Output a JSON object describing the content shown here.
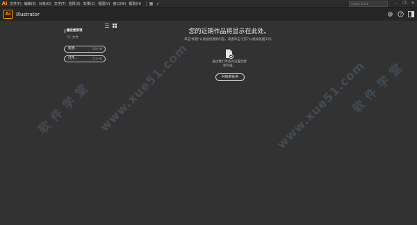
{
  "menubar": {
    "logo": "Ai",
    "items": [
      "文件(F)",
      "编辑(E)",
      "对象(O)",
      "文字(T)",
      "选择(S)",
      "效果(C)",
      "视图(V)",
      "窗口(W)",
      "帮助(H)"
    ],
    "search_placeholder": "Adobe Stock",
    "controls": [
      "–",
      "❐",
      "✕"
    ]
  },
  "header": {
    "logo": "Ai",
    "title": "Illustrator",
    "icons": [
      "gear-icon",
      "help-icon",
      "panel-icon"
    ]
  },
  "sidebar": {
    "recent_label": "最近使用项",
    "cc_label": "CC 文件",
    "new_button": "新建...",
    "new_shortcut": "Ctrl+N",
    "open_button": "打开...",
    "open_shortcut": "Ctrl+O"
  },
  "main": {
    "title": "您的近期作品将显示在此处。",
    "subtitle": "单击\"新建\"以快速创建新内容，或者单击\"打开\"以继续处理工作。",
    "hint_line1": "通过我们带有的设置创建",
    "hint_line2": "新内容。",
    "start_button": "开始新任务"
  },
  "watermarks": [
    "软 件 学 堂",
    "www.xue51.com",
    "www.xue51.com",
    "软 件 学 堂"
  ],
  "colors": {
    "background": "#323232",
    "accent": "#ff9a00"
  }
}
